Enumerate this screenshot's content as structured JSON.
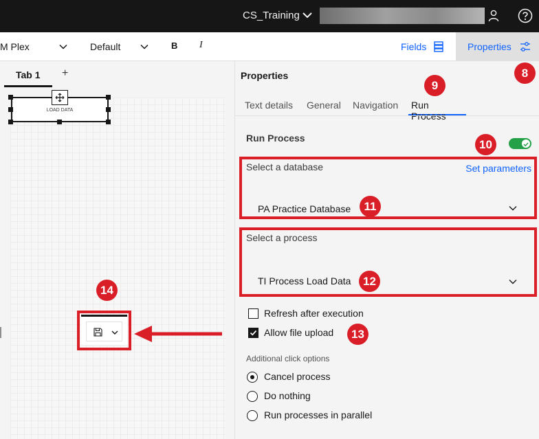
{
  "topbar": {
    "workspace_name": "CS_Training",
    "icons": {
      "chevron": "chevron-down-icon",
      "user": "user-icon",
      "help": "help-icon"
    }
  },
  "toolbar": {
    "font_family": "M Plex",
    "font_style": "Default",
    "bold_label": "B",
    "italic_label": "I",
    "fields_label": "Fields",
    "properties_label": "Properties"
  },
  "canvas": {
    "tab_label": "Tab 1",
    "add_tab_label": "+",
    "widget_label": "LOAD DATA"
  },
  "properties": {
    "title": "Properties",
    "tabs": [
      "Text details",
      "General",
      "Navigation",
      "Run Process"
    ],
    "active_tab": "Run Process",
    "section_title": "Run Process",
    "toggle_on": true,
    "database": {
      "label": "Select a database",
      "link": "Set parameters",
      "value": "PA Practice Database"
    },
    "process": {
      "label": "Select a process",
      "value": "TI Process Load Data"
    },
    "checkboxes": [
      {
        "label": "Refresh after execution",
        "checked": false
      },
      {
        "label": "Allow file upload",
        "checked": true
      }
    ],
    "additional_label": "Additional click options",
    "radios": [
      {
        "label": "Cancel process",
        "selected": true
      },
      {
        "label": "Do nothing",
        "selected": false
      },
      {
        "label": "Run processes in parallel",
        "selected": false
      }
    ]
  },
  "annotations": [
    "8",
    "9",
    "10",
    "11",
    "12",
    "13",
    "14"
  ],
  "colors": {
    "accent": "#0f62fe",
    "annotation": "#da1e28",
    "toggle": "#24a148",
    "topbar": "#161616"
  }
}
